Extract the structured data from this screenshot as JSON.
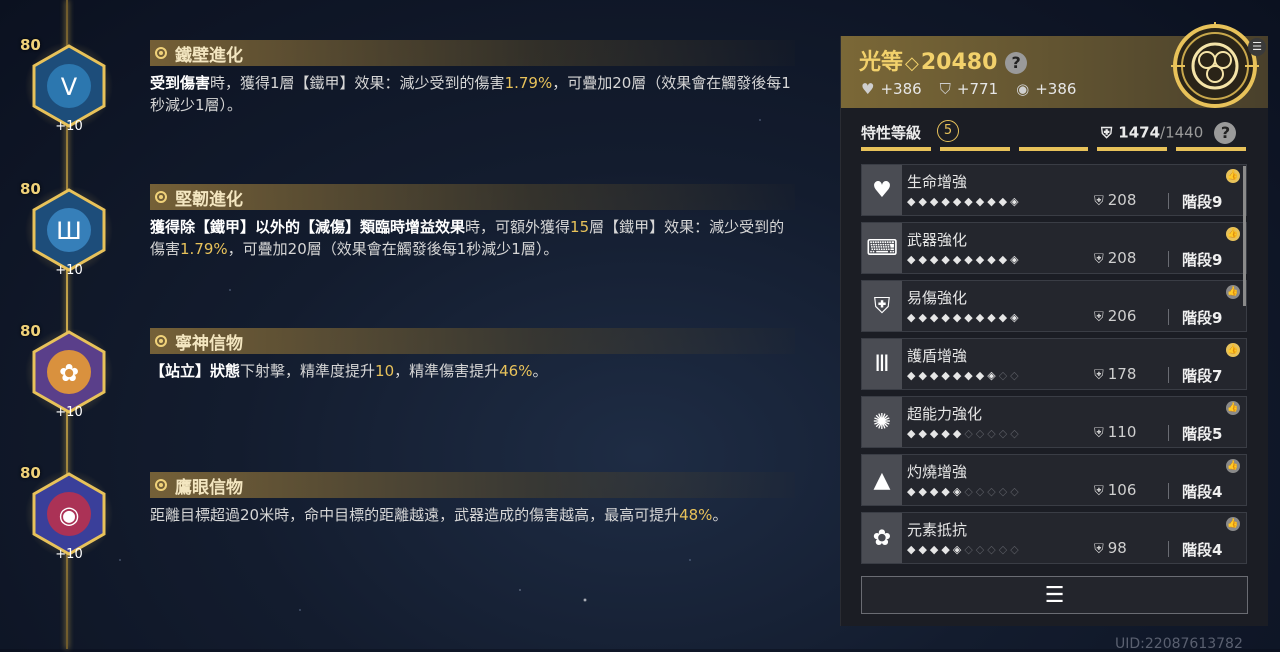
{
  "perks": [
    {
      "level": "80",
      "bonus": "+10",
      "title": "鐵壁進化",
      "desc": [
        {
          "t": "受到傷害",
          "b": true
        },
        {
          "t": "時，獲得1層【鐵甲】效果：減少受到的傷害"
        },
        {
          "t": "1.79%",
          "h": true
        },
        {
          "t": "，可疊加20層（效果會在觸發後每1秒減少1層）。"
        }
      ]
    },
    {
      "level": "80",
      "bonus": "+10",
      "title": "堅韌進化",
      "desc": [
        {
          "t": "獲得除【鐵甲】以外的【減傷】類臨時增益效果",
          "b": true
        },
        {
          "t": "時，可額外獲得"
        },
        {
          "t": "15",
          "h": true
        },
        {
          "t": "層【鐵甲】效果：減少受到的傷害"
        },
        {
          "t": "1.79%",
          "h": true
        },
        {
          "t": "，可疊加20層（效果會在觸發後每1秒減少1層）。"
        }
      ]
    },
    {
      "level": "80",
      "bonus": "+10",
      "title": "寧神信物",
      "desc": [
        {
          "t": "【站立】狀態",
          "b": true
        },
        {
          "t": "下射擊，精準度提升"
        },
        {
          "t": "10",
          "h": true
        },
        {
          "t": "，精準傷害提升"
        },
        {
          "t": "46%",
          "h": true
        },
        {
          "t": "。"
        }
      ]
    },
    {
      "level": "80",
      "bonus": "+10",
      "title": "鷹眼信物",
      "desc": [
        {
          "t": "距離目標超過20米時，命中目標的距離越遠，武器造成的傷害越高，最高可提升"
        },
        {
          "t": "48%",
          "h": true
        },
        {
          "t": "。"
        }
      ]
    }
  ],
  "panel": {
    "power_label": "光等",
    "power_value": "20480",
    "stats": [
      "+386",
      "+771",
      "+386"
    ],
    "trait_label": "特性等級",
    "trait_level": "5",
    "trait_points": "1474",
    "trait_points_max": "/1440",
    "rows": [
      {
        "name": "生命增強",
        "pts": "208",
        "stage": "階段9",
        "filled": 9,
        "partial": true,
        "thumb": "gold",
        "icon": "♥"
      },
      {
        "name": "武器強化",
        "pts": "208",
        "stage": "階段9",
        "filled": 9,
        "partial": true,
        "thumb": "gold",
        "icon": "⌨"
      },
      {
        "name": "易傷強化",
        "pts": "206",
        "stage": "階段9",
        "filled": 9,
        "partial": true,
        "thumb": "grey",
        "icon": "⛨"
      },
      {
        "name": "護盾增強",
        "pts": "178",
        "stage": "階段7",
        "filled": 7,
        "partial": true,
        "thumb": "gold",
        "icon": "Ⅲ"
      },
      {
        "name": "超能力強化",
        "pts": "110",
        "stage": "階段5",
        "filled": 5,
        "partial": false,
        "thumb": "grey",
        "icon": "✺"
      },
      {
        "name": "灼燒增強",
        "pts": "106",
        "stage": "階段4",
        "filled": 4,
        "partial": true,
        "thumb": "grey",
        "icon": "▲"
      },
      {
        "name": "元素抵抗",
        "pts": "98",
        "stage": "階段4",
        "filled": 4,
        "partial": true,
        "thumb": "grey",
        "icon": "✿"
      }
    ]
  },
  "uid": "UID:22087613782",
  "colors": {
    "gold": "#e8c25a",
    "accent": "#f2d16b"
  }
}
